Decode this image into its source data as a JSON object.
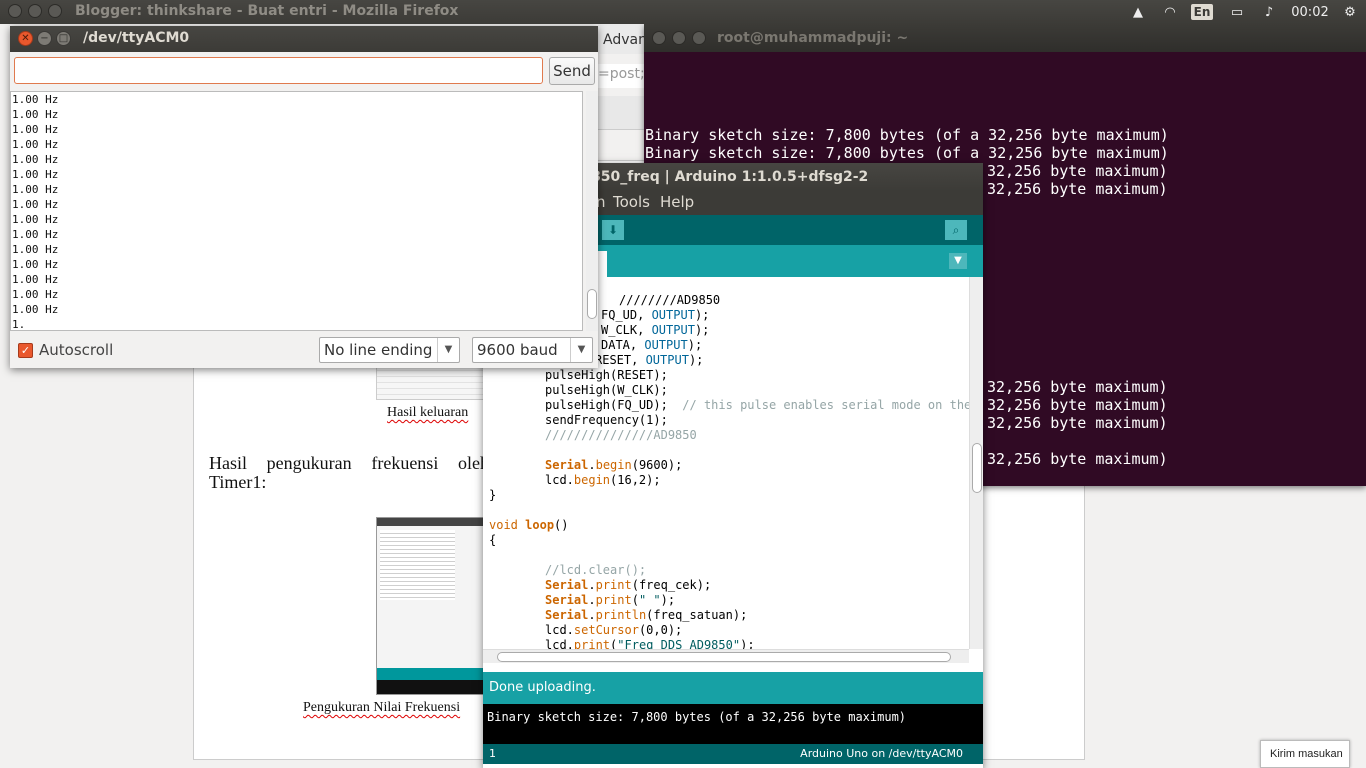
{
  "topbar": {
    "window_title": "Blogger: thinkshare - Buat entri - Mozilla Firefox",
    "lang": "En",
    "clock": "00:02"
  },
  "firefox": {
    "tab_fragment": "Advan",
    "url_fragment": "=post;",
    "doc_text": "Hasil pengukuran frekuensi oleh Timer1:",
    "caption1": "Hasil keluaran",
    "caption2": "Pengukuran Nilai Frekuensi",
    "kirim": "Kirim masukan"
  },
  "terminal": {
    "title": "root@muhammadpuji: ~",
    "lines_top": [
      "Binary sketch size: 7,800 bytes (of a 32,256 byte maximum)",
      "Binary sketch size: 7,800 bytes (of a 32,256 byte maximum)",
      "32,256 byte maximum)",
      "32,256 byte maximum)"
    ],
    "lines_bottom": [
      "32,256 byte maximum)",
      "32,256 byte maximum)",
      "32,256 byte maximum)",
      "32,256 byte maximum)"
    ]
  },
  "ide": {
    "title": "850_freq | Arduino 1:1.0.5+dfsg2-2",
    "menu": {
      "partial": "n",
      "tools": "Tools",
      "help": "Help"
    },
    "status": "Done uploading.",
    "console": "Binary sketch size: 7,800 bytes (of a 32,256 byte maximum)",
    "line_no": "1",
    "board": "Arduino Uno on /dev/ttyACM0",
    "code": {
      "l1": "////////AD9850",
      "l2a": "FQ_UD, ",
      "l2b": "OUTPUT",
      "l2c": ");",
      "l3a": "W_CLK, ",
      "l3b": "OUTPUT",
      "l3c": ");",
      "l4a": "DATA, ",
      "l4b": "OUTPUT",
      "l4c": ");",
      "l5a": "RESET, ",
      "l5b": "OUTPUT",
      "l5c": ");",
      "l6": "pulseHigh(RESET);",
      "l7": "pulseHigh(W_CLK);",
      "l8a": "pulseHigh(FQ_UD);  ",
      "l8b": "// this pulse enables serial mode on the",
      "l9": "sendFrequency(1);",
      "l10": "///////////////AD9850",
      "l11a": "Serial",
      "l11b": ".",
      "l11c": "begin",
      "l11d": "(9600);",
      "l12a": "lcd.",
      "l12b": "begin",
      "l12c": "(16,2);",
      "l13": "}",
      "l14a": "void",
      "l14b": " ",
      "l14c": "loop",
      "l14d": "()",
      "l15": "{",
      "l16": "//lcd.clear();",
      "l17a": "Serial",
      "l17b": ".",
      "l17c": "print",
      "l17d": "(freq_cek);",
      "l18a": "Serial",
      "l18b": ".",
      "l18c": "print",
      "l18d": "(",
      "l18e": "\" \"",
      "l18f": ");",
      "l19a": "Serial",
      "l19b": ".",
      "l19c": "println",
      "l19d": "(freq_satuan);",
      "l20a": "lcd.",
      "l20b": "setCursor",
      "l20c": "(0,0);",
      "l21a": "lcd.",
      "l21b": "print",
      "l21c": "(",
      "l21d": "\"Freq DDS AD9850\"",
      "l21e": ");"
    }
  },
  "serial": {
    "title": "/dev/ttyACM0",
    "input_value": "",
    "send_label": "Send",
    "output": [
      "1.00 Hz",
      "1.00 Hz",
      "1.00 Hz",
      "1.00 Hz",
      "1.00 Hz",
      "1.00 Hz",
      "1.00 Hz",
      "1.00 Hz",
      "1.00 Hz",
      "1.00 Hz",
      "1.00 Hz",
      "1.00 Hz",
      "1.00 Hz",
      "1.00 Hz",
      "1.00 Hz",
      "1."
    ],
    "autoscroll_label": "Autoscroll",
    "line_ending": "No line ending",
    "baud": "9600 baud"
  },
  "colors": {
    "terminal_bg": "#300a24",
    "arduino_teal": "#00979c",
    "arduino_dark": "#006468",
    "ubuntu_orange": "#e9582d"
  }
}
